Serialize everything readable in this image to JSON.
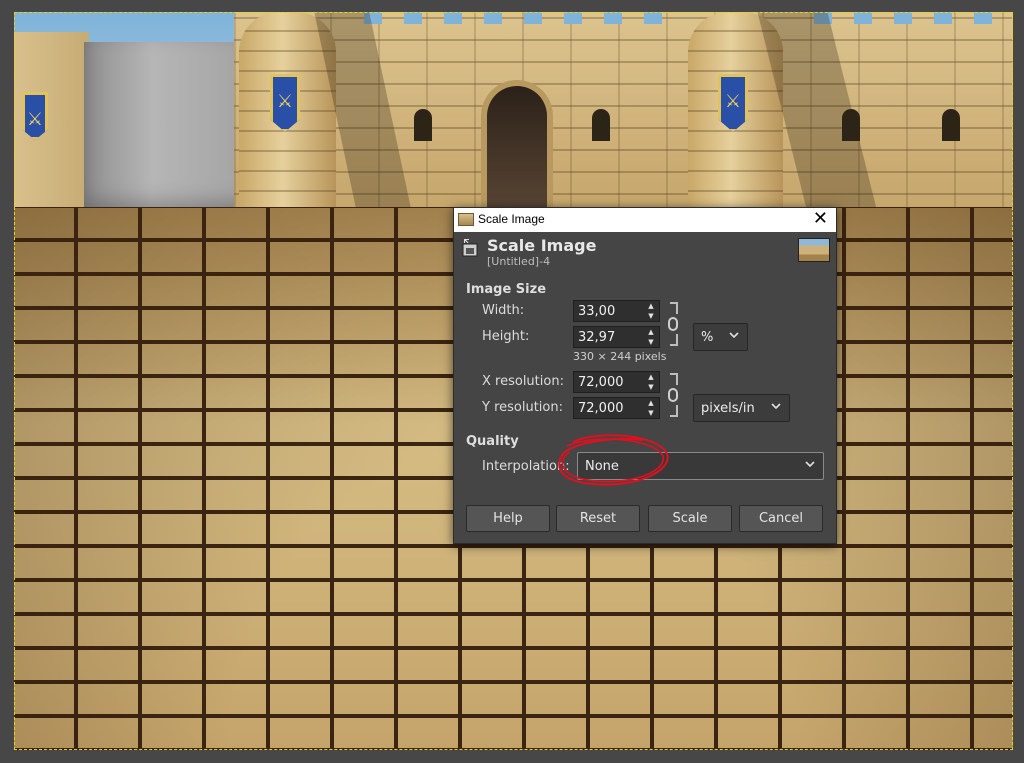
{
  "window": {
    "title": "Scale Image",
    "close_glyph": "✕"
  },
  "header": {
    "title": "Scale Image",
    "subtitle": "[Untitled]-4"
  },
  "image_size": {
    "section_label": "Image Size",
    "width_label": "Width:",
    "width_value": "33,00",
    "height_label": "Height:",
    "height_value": "32,97",
    "unit": "%",
    "pixel_hint": "330 × 244 pixels",
    "xres_label": "X resolution:",
    "xres_value": "72,000",
    "yres_label": "Y resolution:",
    "yres_value": "72,000",
    "res_unit": "pixels/in"
  },
  "quality": {
    "section_label": "Quality",
    "interpolation_label": "Interpolation:",
    "interpolation_value": "None"
  },
  "buttons": {
    "help": "Help",
    "reset": "Reset",
    "scale": "Scale",
    "cancel": "Cancel"
  },
  "icons": {
    "chain": "chain-link-icon",
    "spin_up": "▲",
    "spin_down": "▼"
  },
  "colors": {
    "dialog_bg": "#454545",
    "annotation_red": "#e0101e",
    "canvas_border": "#e8d21a"
  }
}
